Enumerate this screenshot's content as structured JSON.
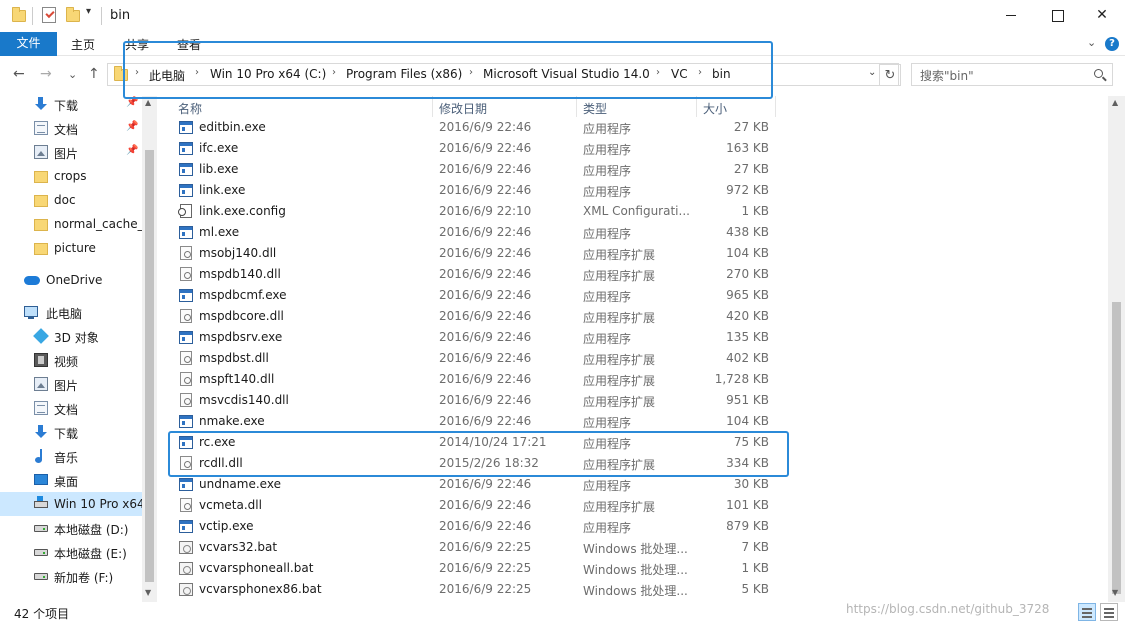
{
  "window": {
    "title": "bin",
    "qa_dropdown": "▾",
    "min_label": "",
    "max_label": "",
    "close_label": "✕"
  },
  "ribbon": {
    "tabs": [
      {
        "label": "文件"
      },
      {
        "label": "主页"
      },
      {
        "label": "共享"
      },
      {
        "label": "查看"
      }
    ],
    "collapse_glyph": "⌄",
    "help_glyph": "?"
  },
  "nav": {
    "back": "←",
    "forward": "→",
    "recent": "⌄",
    "up": "↑",
    "refresh": "↻",
    "address_dropdown": "⌄"
  },
  "breadcrumb": [
    {
      "label": "此电脑"
    },
    {
      "label": "Win 10 Pro x64 (C:)"
    },
    {
      "label": "Program Files (x86)"
    },
    {
      "label": "Microsoft Visual Studio 14.0"
    },
    {
      "label": "VC"
    },
    {
      "label": "bin"
    }
  ],
  "breadcrumb_sep": "›",
  "search": {
    "placeholder": "搜索\"bin\""
  },
  "columns": {
    "name": "名称",
    "date": "修改日期",
    "type": "类型",
    "size": "大小",
    "sort_glyph": "^"
  },
  "sidebar": [
    {
      "label": "下载",
      "icon": "download-icon",
      "pinned": true
    },
    {
      "label": "文档",
      "icon": "document-icon",
      "pinned": true
    },
    {
      "label": "图片",
      "icon": "pictures-icon",
      "pinned": true
    },
    {
      "label": "crops",
      "icon": "folder-icon"
    },
    {
      "label": "doc",
      "icon": "folder-icon"
    },
    {
      "label": "normal_cache_",
      "icon": "folder-icon"
    },
    {
      "label": "picture",
      "icon": "folder-icon"
    },
    {
      "label": "OneDrive",
      "icon": "onedrive-icon"
    },
    {
      "label": "此电脑",
      "icon": "computer-icon"
    },
    {
      "label": "3D 对象",
      "icon": "3d-objects-icon"
    },
    {
      "label": "视频",
      "icon": "video-icon"
    },
    {
      "label": "图片",
      "icon": "pictures-icon"
    },
    {
      "label": "文档",
      "icon": "document-icon"
    },
    {
      "label": "下载",
      "icon": "download-icon"
    },
    {
      "label": "音乐",
      "icon": "music-icon"
    },
    {
      "label": "桌面",
      "icon": "desktop-icon"
    },
    {
      "label": "Win 10 Pro x64",
      "icon": "os-drive-icon",
      "selected": true
    },
    {
      "label": "本地磁盘 (D:)",
      "icon": "drive-icon"
    },
    {
      "label": "本地磁盘 (E:)",
      "icon": "drive-icon"
    },
    {
      "label": "新加卷 (F:)",
      "icon": "drive-icon"
    }
  ],
  "pin_glyph": "📌",
  "files": [
    {
      "name": "editbin.exe",
      "date": "2016/6/9 22:46",
      "type": "应用程序",
      "size": "27 KB",
      "icon": "exe-icon"
    },
    {
      "name": "ifc.exe",
      "date": "2016/6/9 22:46",
      "type": "应用程序",
      "size": "163 KB",
      "icon": "exe-icon"
    },
    {
      "name": "lib.exe",
      "date": "2016/6/9 22:46",
      "type": "应用程序",
      "size": "27 KB",
      "icon": "exe-icon"
    },
    {
      "name": "link.exe",
      "date": "2016/6/9 22:46",
      "type": "应用程序",
      "size": "972 KB",
      "icon": "exe-icon"
    },
    {
      "name": "link.exe.config",
      "date": "2016/6/9 22:10",
      "type": "XML Configurati...",
      "size": "1 KB",
      "icon": "config-icon"
    },
    {
      "name": "ml.exe",
      "date": "2016/6/9 22:46",
      "type": "应用程序",
      "size": "438 KB",
      "icon": "exe-icon"
    },
    {
      "name": "msobj140.dll",
      "date": "2016/6/9 22:46",
      "type": "应用程序扩展",
      "size": "104 KB",
      "icon": "dll-icon"
    },
    {
      "name": "mspdb140.dll",
      "date": "2016/6/9 22:46",
      "type": "应用程序扩展",
      "size": "270 KB",
      "icon": "dll-icon"
    },
    {
      "name": "mspdbcmf.exe",
      "date": "2016/6/9 22:46",
      "type": "应用程序",
      "size": "965 KB",
      "icon": "exe-icon"
    },
    {
      "name": "mspdbcore.dll",
      "date": "2016/6/9 22:46",
      "type": "应用程序扩展",
      "size": "420 KB",
      "icon": "dll-icon"
    },
    {
      "name": "mspdbsrv.exe",
      "date": "2016/6/9 22:46",
      "type": "应用程序",
      "size": "135 KB",
      "icon": "exe-icon"
    },
    {
      "name": "mspdbst.dll",
      "date": "2016/6/9 22:46",
      "type": "应用程序扩展",
      "size": "402 KB",
      "icon": "dll-icon"
    },
    {
      "name": "mspft140.dll",
      "date": "2016/6/9 22:46",
      "type": "应用程序扩展",
      "size": "1,728 KB",
      "icon": "dll-icon"
    },
    {
      "name": "msvcdis140.dll",
      "date": "2016/6/9 22:46",
      "type": "应用程序扩展",
      "size": "951 KB",
      "icon": "dll-icon"
    },
    {
      "name": "nmake.exe",
      "date": "2016/6/9 22:46",
      "type": "应用程序",
      "size": "104 KB",
      "icon": "exe-icon"
    },
    {
      "name": "rc.exe",
      "date": "2014/10/24 17:21",
      "type": "应用程序",
      "size": "75 KB",
      "icon": "exe-icon"
    },
    {
      "name": "rcdll.dll",
      "date": "2015/2/26 18:32",
      "type": "应用程序扩展",
      "size": "334 KB",
      "icon": "dll-icon"
    },
    {
      "name": "undname.exe",
      "date": "2016/6/9 22:46",
      "type": "应用程序",
      "size": "30 KB",
      "icon": "exe-icon"
    },
    {
      "name": "vcmeta.dll",
      "date": "2016/6/9 22:46",
      "type": "应用程序扩展",
      "size": "101 KB",
      "icon": "dll-icon"
    },
    {
      "name": "vctip.exe",
      "date": "2016/6/9 22:46",
      "type": "应用程序",
      "size": "879 KB",
      "icon": "exe-icon"
    },
    {
      "name": "vcvars32.bat",
      "date": "2016/6/9 22:25",
      "type": "Windows 批处理...",
      "size": "7 KB",
      "icon": "bat-icon"
    },
    {
      "name": "vcvarsphoneall.bat",
      "date": "2016/6/9 22:25",
      "type": "Windows 批处理...",
      "size": "1 KB",
      "icon": "bat-icon"
    },
    {
      "name": "vcvarsphonex86.bat",
      "date": "2016/6/9 22:25",
      "type": "Windows 批处理...",
      "size": "5 KB",
      "icon": "bat-icon"
    }
  ],
  "status": {
    "item_count": "42 个项目",
    "watermark": "https://blog.csdn.net/github_3728"
  },
  "colors": {
    "accent": "#1979ca",
    "highlight_box": "#2b8ad8",
    "selected_bg": "#cce8ff"
  }
}
